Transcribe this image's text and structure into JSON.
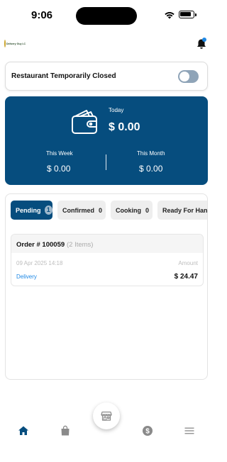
{
  "status_bar": {
    "time": "9:06"
  },
  "header": {
    "logo_text": "Delivery Guy LC",
    "logo_icon": "restaurant-logo",
    "notification_icon": "bell-icon"
  },
  "store_status": {
    "label": "Restaurant Temporarily Closed",
    "toggle_on": false
  },
  "earnings": {
    "icon": "wallet-icon",
    "today_label": "Today",
    "today_value": "$ 0.00",
    "week_label": "This Week",
    "week_value": "$ 0.00",
    "month_label": "This Month",
    "month_value": "$ 0.00",
    "card_color": "#064d7e"
  },
  "order_tabs": [
    {
      "label": "Pending",
      "count": "1",
      "active": true
    },
    {
      "label": "Confirmed",
      "count": "0",
      "active": false
    },
    {
      "label": "Cooking",
      "count": "0",
      "active": false
    },
    {
      "label": "Ready For Handover",
      "count": "",
      "active": false
    }
  ],
  "orders": [
    {
      "number": "Order # 100059",
      "items": "(2 Items)",
      "date": "09 Apr 2025  14:18",
      "amount_label": "Amount",
      "type": "Delivery",
      "amount": "$ 24.47"
    }
  ],
  "bottom_nav": [
    {
      "icon": "home-icon",
      "active": true
    },
    {
      "icon": "shopping-bag-icon",
      "active": false
    },
    {
      "icon": "store-icon",
      "active": false
    },
    {
      "icon": "dollar-icon",
      "active": false
    },
    {
      "icon": "menu-icon",
      "active": false
    }
  ],
  "colors": {
    "primary": "#064d7e",
    "link": "#1e88e5",
    "nav_icon": "#8a8a8a"
  }
}
